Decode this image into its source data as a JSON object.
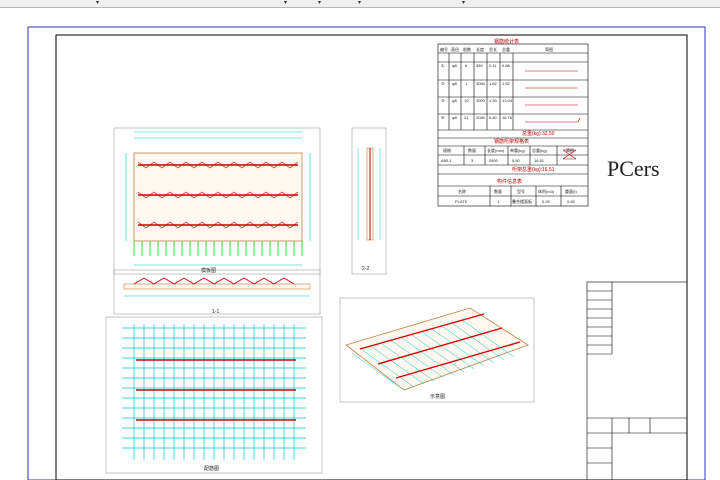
{
  "toolbar": {
    "items": [
      "",
      "",
      "",
      "",
      "",
      "",
      "",
      "",
      ""
    ]
  },
  "sheet": {
    "watermark": "PCers"
  },
  "table1": {
    "title": "钢筋统计表",
    "headers": [
      "编号",
      "直径",
      "根数",
      "长度",
      "总长",
      "总重",
      "简图"
    ],
    "rows": [
      [
        "①",
        "φ8",
        "6",
        "380",
        "0.11",
        "0.88",
        ""
      ],
      [
        "②",
        "φ8",
        "1",
        "3060",
        "1.82",
        "1.82",
        ""
      ],
      [
        "③",
        "φ8",
        "10",
        "3000",
        "1.30",
        "13.04",
        ""
      ],
      [
        "④",
        "φ8",
        "21",
        "2080",
        "0.80",
        "16.76",
        ""
      ]
    ],
    "total": "总重(kg):32.50"
  },
  "table2": {
    "title": "钢筋桁架规格表",
    "headers": [
      "规格",
      "数量",
      "长度(mm)",
      "单重(kg)",
      "总重(kg)",
      "简图"
    ],
    "rows": [
      [
        "A80-1",
        "3",
        "2800",
        "5.50",
        "16.51",
        ""
      ]
    ],
    "total": "桁架总重(kg):16.51"
  },
  "table3": {
    "title": "构件信息表",
    "headers": [
      "名称",
      "数量",
      "型号",
      "体积(m3)",
      "重量(t)"
    ],
    "rows": [
      [
        "PLATE",
        "1",
        "叠合楼面板",
        "0.26",
        "0.65"
      ]
    ]
  },
  "views": {
    "plan_label": "模板图",
    "side_label": "2-2",
    "section_label": "1-1",
    "rebar_label": "配筋图",
    "iso_label": "示意图"
  }
}
